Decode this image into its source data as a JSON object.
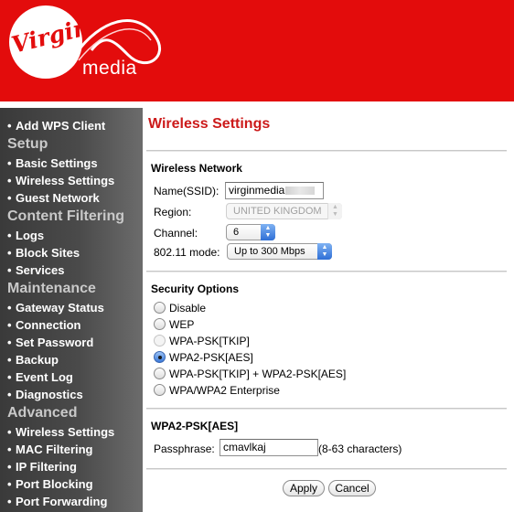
{
  "header": {
    "brand_script": "Virgin",
    "brand_word": "media",
    "bg_color": "#e30c0c"
  },
  "sidebar": {
    "items": [
      {
        "type": "item",
        "bullet": "•",
        "label": "Add WPS Client"
      },
      {
        "type": "section",
        "label": "Setup"
      },
      {
        "type": "item",
        "bullet": "•",
        "label": "Basic Settings"
      },
      {
        "type": "item",
        "bullet": "•",
        "label": "Wireless Settings"
      },
      {
        "type": "item",
        "bullet": "•",
        "label": "Guest Network"
      },
      {
        "type": "section",
        "label": "Content Filtering"
      },
      {
        "type": "item",
        "bullet": "•",
        "label": "Logs"
      },
      {
        "type": "item",
        "bullet": "•",
        "label": "Block Sites"
      },
      {
        "type": "item",
        "bullet": "•",
        "label": "Services"
      },
      {
        "type": "section",
        "label": "Maintenance"
      },
      {
        "type": "item",
        "bullet": "•",
        "label": "Gateway Status"
      },
      {
        "type": "item",
        "bullet": "•",
        "label": "Connection"
      },
      {
        "type": "item",
        "bullet": "•",
        "label": "Set Password"
      },
      {
        "type": "item",
        "bullet": "•",
        "label": "Backup"
      },
      {
        "type": "item",
        "bullet": "•",
        "label": "Event Log"
      },
      {
        "type": "item",
        "bullet": "•",
        "label": "Diagnostics"
      },
      {
        "type": "section",
        "label": "Advanced"
      },
      {
        "type": "item",
        "bullet": "•",
        "label": "Wireless Settings"
      },
      {
        "type": "item",
        "bullet": "•",
        "label": "MAC Filtering"
      },
      {
        "type": "item",
        "bullet": "•",
        "label": "IP Filtering"
      },
      {
        "type": "item",
        "bullet": "•",
        "label": "Port Blocking"
      },
      {
        "type": "item",
        "bullet": "•",
        "label": "Port Forwarding"
      }
    ]
  },
  "main": {
    "title": "Wireless Settings",
    "wireless_network": {
      "heading": "Wireless Network",
      "ssid_label": "Name(SSID):",
      "ssid_value": "virginmedia",
      "region_label": "Region:",
      "region_value": "UNITED KINGDOM",
      "channel_label": "Channel:",
      "channel_value": "6",
      "mode_label": "802.11 mode:",
      "mode_value": "Up to 300 Mbps"
    },
    "security": {
      "heading": "Security Options",
      "options": [
        {
          "label": "Disable",
          "checked": false,
          "disabled": false
        },
        {
          "label": "WEP",
          "checked": false,
          "disabled": false
        },
        {
          "label": "WPA-PSK[TKIP]",
          "checked": false,
          "disabled": true
        },
        {
          "label": "WPA2-PSK[AES]",
          "checked": true,
          "disabled": false
        },
        {
          "label": "WPA-PSK[TKIP] + WPA2-PSK[AES]",
          "checked": false,
          "disabled": false
        },
        {
          "label": "WPA/WPA2 Enterprise",
          "checked": false,
          "disabled": false
        }
      ]
    },
    "wpa2": {
      "heading": "WPA2-PSK[AES]",
      "passphrase_label": "Passphrase:",
      "passphrase_value": "cmavlkaj",
      "passphrase_hint": "(8-63 characters)"
    },
    "buttons": {
      "apply": "Apply",
      "cancel": "Cancel"
    }
  }
}
